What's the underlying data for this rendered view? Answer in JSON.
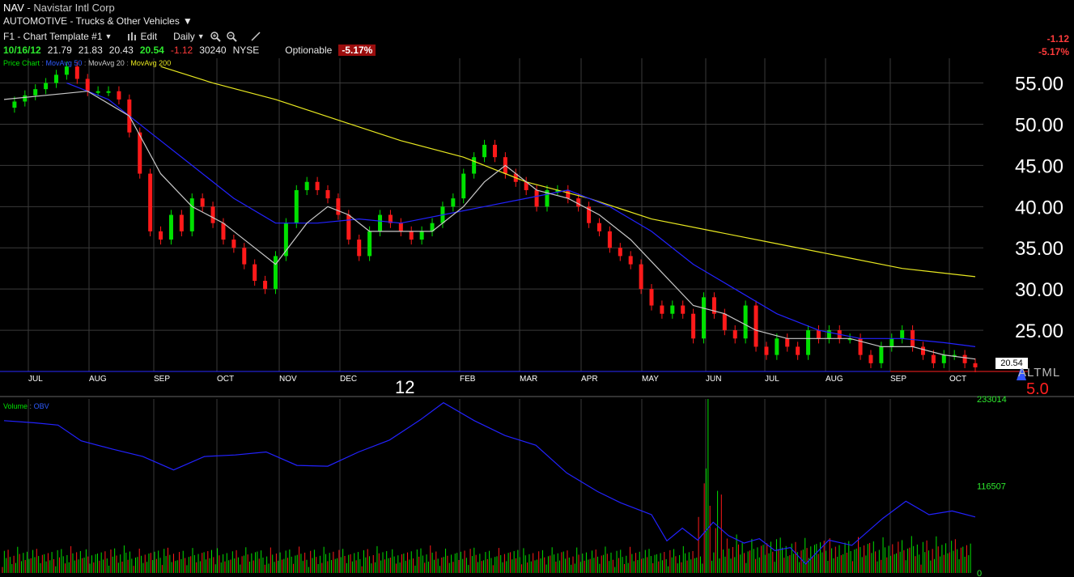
{
  "header": {
    "symbol": "NAV",
    "company": "Navistar Intl Corp",
    "sector": "AUTOMOTIVE - Trucks & Other Vehicles",
    "template": "F1 - Chart Template #1",
    "edit_label": "Edit",
    "interval": "Daily",
    "optionable_label": "Optionable"
  },
  "quote": {
    "date": "10/16/12",
    "open": "21.79",
    "high": "21.83",
    "low": "20.43",
    "last": "20.54",
    "change": "-1.12",
    "volume": "30240",
    "exchange": "NYSE",
    "pct_change": "-5.17%"
  },
  "right_panel": {
    "change": "-1.12",
    "pct_change": "-5.17%",
    "last_price_box": "20.54",
    "altml": "ALTML",
    "scale_value": "5.0",
    "year_marker": "12"
  },
  "legends": {
    "price": [
      "Price Chart",
      "MovAvg 50",
      "MovAvg 20",
      "MovAvg 200"
    ],
    "volume": [
      "Volume",
      "OBV"
    ]
  },
  "colors": {
    "up": "#00e000",
    "down": "#ff1a1a",
    "ma50": "#2222ff",
    "ma20": "#c8c8c8",
    "ma200": "#e8e820",
    "grid": "#3a3a3a",
    "obv": "#2222ff",
    "pct_bg": "#9b0d0d"
  },
  "chart_data": [
    {
      "type": "candlestick",
      "title": "",
      "series": [
        {
          "name": "Price Chart"
        },
        {
          "name": "MovAvg 50"
        },
        {
          "name": "MovAvg 20"
        },
        {
          "name": "MovAvg 200"
        }
      ],
      "y_ticks": [
        "55.00",
        "50.00",
        "45.00",
        "40.00",
        "35.00",
        "30.00",
        "25.00"
      ],
      "ylim": [
        20,
        58
      ],
      "x_ticks": [
        "JUL",
        "AUG",
        "SEP",
        "OCT",
        "NOV",
        "DEC",
        "FEB",
        "MAR",
        "APR",
        "MAY",
        "JUN",
        "JUL",
        "AUG",
        "SEP",
        "OCT"
      ],
      "x_label_year": "12",
      "grid": true,
      "close_path": [
        [
          0,
          52
        ],
        [
          4,
          55
        ],
        [
          6,
          57
        ],
        [
          8,
          54
        ],
        [
          10,
          54
        ],
        [
          11,
          53
        ],
        [
          12,
          49
        ],
        [
          13,
          44
        ],
        [
          14,
          37
        ],
        [
          15,
          36
        ],
        [
          16,
          39
        ],
        [
          17,
          37
        ],
        [
          18,
          41
        ],
        [
          19,
          40
        ],
        [
          20,
          38
        ],
        [
          21,
          36
        ],
        [
          22,
          35
        ],
        [
          23,
          33
        ],
        [
          24,
          31
        ],
        [
          25,
          30
        ],
        [
          26,
          34
        ],
        [
          27,
          38
        ],
        [
          28,
          42
        ],
        [
          29,
          43
        ],
        [
          30,
          42
        ],
        [
          31,
          41
        ],
        [
          32,
          39
        ],
        [
          33,
          36
        ],
        [
          34,
          34
        ],
        [
          35,
          37
        ],
        [
          36,
          39
        ],
        [
          37,
          38
        ],
        [
          38,
          37
        ],
        [
          39,
          36
        ],
        [
          40,
          37
        ],
        [
          41,
          38
        ],
        [
          42,
          40
        ],
        [
          43,
          41
        ],
        [
          44,
          44
        ],
        [
          45,
          46
        ],
        [
          46,
          47.5
        ],
        [
          47,
          46
        ],
        [
          48,
          44
        ],
        [
          49,
          43
        ],
        [
          50,
          42
        ],
        [
          51,
          40
        ],
        [
          52,
          42
        ],
        [
          53,
          42
        ],
        [
          54,
          41
        ],
        [
          55,
          40
        ],
        [
          56,
          38
        ],
        [
          57,
          37
        ],
        [
          58,
          35
        ],
        [
          59,
          34
        ],
        [
          60,
          33
        ],
        [
          61,
          30
        ],
        [
          62,
          28
        ],
        [
          63,
          27
        ],
        [
          64,
          28
        ],
        [
          65,
          27
        ],
        [
          66,
          24
        ],
        [
          67,
          29
        ],
        [
          68,
          27
        ],
        [
          69,
          25
        ],
        [
          70,
          24
        ],
        [
          71,
          28
        ],
        [
          72,
          23
        ],
        [
          73,
          22
        ],
        [
          74,
          24
        ],
        [
          75,
          23
        ],
        [
          76,
          22
        ],
        [
          77,
          25
        ],
        [
          78,
          24
        ],
        [
          79,
          25
        ],
        [
          80,
          24
        ],
        [
          81,
          24
        ],
        [
          82,
          22
        ],
        [
          83,
          21
        ],
        [
          84,
          23
        ],
        [
          85,
          24
        ],
        [
          86,
          25
        ],
        [
          87,
          23
        ],
        [
          88,
          22
        ],
        [
          89,
          21
        ],
        [
          90,
          22
        ],
        [
          91,
          22
        ],
        [
          92,
          21
        ],
        [
          93,
          20.5
        ]
      ],
      "ma20_path": [
        [
          0,
          53
        ],
        [
          8,
          54
        ],
        [
          12,
          51
        ],
        [
          15,
          44
        ],
        [
          18,
          40
        ],
        [
          21,
          38
        ],
        [
          24,
          35
        ],
        [
          26,
          33
        ],
        [
          29,
          38
        ],
        [
          31,
          40
        ],
        [
          33,
          39
        ],
        [
          35,
          37
        ],
        [
          38,
          37
        ],
        [
          41,
          37
        ],
        [
          44,
          40
        ],
        [
          46,
          43
        ],
        [
          48,
          45
        ],
        [
          51,
          42
        ],
        [
          54,
          41
        ],
        [
          57,
          39
        ],
        [
          60,
          36
        ],
        [
          63,
          32
        ],
        [
          66,
          28
        ],
        [
          69,
          27
        ],
        [
          72,
          25
        ],
        [
          75,
          24
        ],
        [
          78,
          24
        ],
        [
          81,
          24
        ],
        [
          84,
          23
        ],
        [
          87,
          23
        ],
        [
          90,
          22
        ],
        [
          93,
          21.5
        ]
      ],
      "ma50_path": [
        [
          6,
          55
        ],
        [
          10,
          53
        ],
        [
          14,
          49
        ],
        [
          18,
          45
        ],
        [
          22,
          41
        ],
        [
          26,
          38
        ],
        [
          30,
          38
        ],
        [
          34,
          38.5
        ],
        [
          38,
          38
        ],
        [
          42,
          39
        ],
        [
          46,
          40
        ],
        [
          50,
          41
        ],
        [
          54,
          42
        ],
        [
          58,
          40
        ],
        [
          62,
          37
        ],
        [
          66,
          33
        ],
        [
          70,
          30
        ],
        [
          74,
          27
        ],
        [
          78,
          25
        ],
        [
          82,
          24
        ],
        [
          86,
          24
        ],
        [
          90,
          23.5
        ],
        [
          93,
          23
        ]
      ],
      "ma200_path": [
        [
          15,
          57
        ],
        [
          20,
          55
        ],
        [
          26,
          53
        ],
        [
          32,
          50.5
        ],
        [
          38,
          48
        ],
        [
          44,
          46
        ],
        [
          50,
          43
        ],
        [
          56,
          41
        ],
        [
          62,
          38.5
        ],
        [
          68,
          37
        ],
        [
          74,
          35.5
        ],
        [
          80,
          34
        ],
        [
          86,
          32.5
        ],
        [
          93,
          31.5
        ]
      ]
    },
    {
      "type": "bar",
      "title": "",
      "series": [
        {
          "name": "Volume"
        },
        {
          "name": "OBV"
        }
      ],
      "y_ticks": [
        "233014",
        "116507",
        "0"
      ],
      "ylim": [
        0,
        233014
      ],
      "obv_path": [
        [
          0,
          204000
        ],
        [
          4,
          201000
        ],
        [
          7,
          198000
        ],
        [
          10,
          177000
        ],
        [
          14,
          166000
        ],
        [
          18,
          156000
        ],
        [
          22,
          138000
        ],
        [
          26,
          156000
        ],
        [
          30,
          158000
        ],
        [
          34,
          162000
        ],
        [
          38,
          144000
        ],
        [
          42,
          143000
        ],
        [
          46,
          162000
        ],
        [
          50,
          178000
        ],
        [
          54,
          205000
        ],
        [
          57,
          228000
        ],
        [
          61,
          204000
        ],
        [
          65,
          184000
        ],
        [
          69,
          171000
        ],
        [
          73,
          134000
        ],
        [
          77,
          109000
        ],
        [
          80,
          94000
        ],
        [
          84,
          78000
        ],
        [
          86,
          43000
        ],
        [
          88,
          60000
        ],
        [
          90,
          44000
        ],
        [
          92,
          68000
        ],
        [
          94,
          50000
        ],
        [
          96,
          40000
        ],
        [
          98,
          46000
        ],
        [
          100,
          30000
        ],
        [
          102,
          34000
        ],
        [
          104,
          12000
        ],
        [
          107,
          44000
        ],
        [
          110,
          37000
        ],
        [
          114,
          73000
        ],
        [
          117,
          96000
        ],
        [
          120,
          78000
        ],
        [
          123,
          83000
        ],
        [
          126,
          75000
        ]
      ],
      "volume_scale_note": "",
      "spike_max": 233014
    }
  ]
}
